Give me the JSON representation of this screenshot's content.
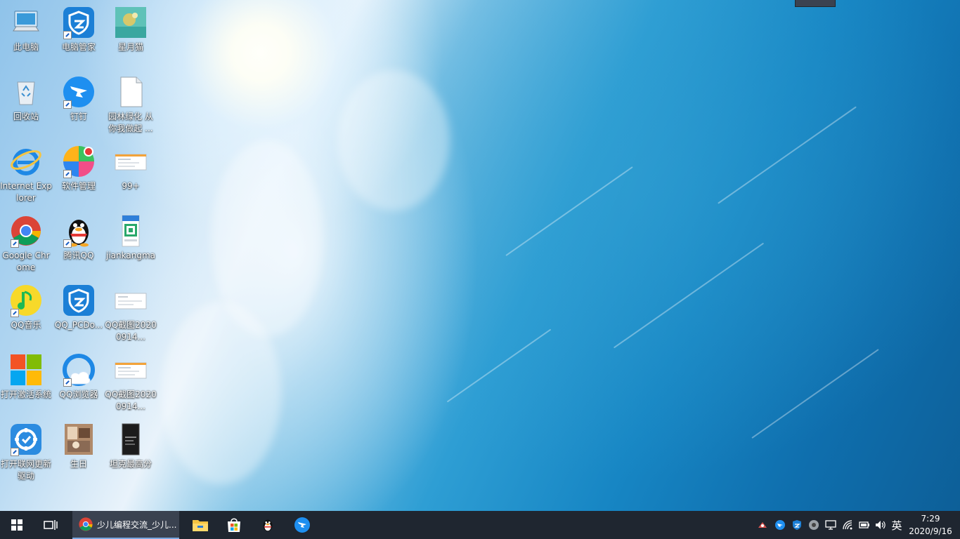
{
  "desktop": {
    "icons": [
      {
        "label": "此电脑",
        "icon": "computer-icon"
      },
      {
        "label": "电脑管家",
        "icon": "tencent-pc-manager-icon"
      },
      {
        "label": "星月猫",
        "icon": "image-file-icon"
      },
      {
        "label": "回收站",
        "icon": "recycle-bin-icon"
      },
      {
        "label": "钉钉",
        "icon": "dingtalk-icon"
      },
      {
        "label": "园林绿化 从你我做起 ...",
        "icon": "document-icon"
      },
      {
        "label": "Internet Explorer",
        "icon": "internet-explorer-icon"
      },
      {
        "label": "软件管理",
        "icon": "software-manager-icon"
      },
      {
        "label": "99+",
        "icon": "screenshot-file-icon"
      },
      {
        "label": "Google Chrome",
        "icon": "chrome-icon"
      },
      {
        "label": "腾讯QQ",
        "icon": "qq-penguin-icon"
      },
      {
        "label": "jiankangma",
        "icon": "qr-image-icon"
      },
      {
        "label": "QQ音乐",
        "icon": "qq-music-icon"
      },
      {
        "label": "QQ_PCDo...",
        "icon": "pc-manager-shield-icon"
      },
      {
        "label": "QQ截图20200914...",
        "icon": "screenshot-file-icon"
      },
      {
        "label": "打开激活系统",
        "icon": "windows-logo-icon"
      },
      {
        "label": "QQ浏览器",
        "icon": "qq-browser-icon"
      },
      {
        "label": "QQ截图20200914...",
        "icon": "screenshot-file-icon"
      },
      {
        "label": "打开联网更新驱动",
        "icon": "driver-update-icon"
      },
      {
        "label": "生日",
        "icon": "photo-file-icon"
      },
      {
        "label": "坦克最高分",
        "icon": "dark-image-icon"
      }
    ]
  },
  "taskbar": {
    "start_icon": "windows-start-icon",
    "task_view_icon": "task-view-icon",
    "active_app": {
      "icon": "chrome-icon",
      "title": "少儿编程交流_少儿..."
    },
    "pinned": [
      "file-explorer-icon",
      "microsoft-store-icon",
      "qq-penguin-icon",
      "dingtalk-icon"
    ],
    "tray": [
      "security-app-icon",
      "dingtalk-tray-icon",
      "pc-manager-tray-icon",
      "audio-card-icon",
      "display-icon",
      "wifi-icon",
      "battery-icon",
      "volume-icon"
    ],
    "ime": "英",
    "time": "7:29",
    "date": "2020/9/16"
  },
  "colors": {
    "taskbar": "#1f2630",
    "accent": "#1b7fd6"
  }
}
